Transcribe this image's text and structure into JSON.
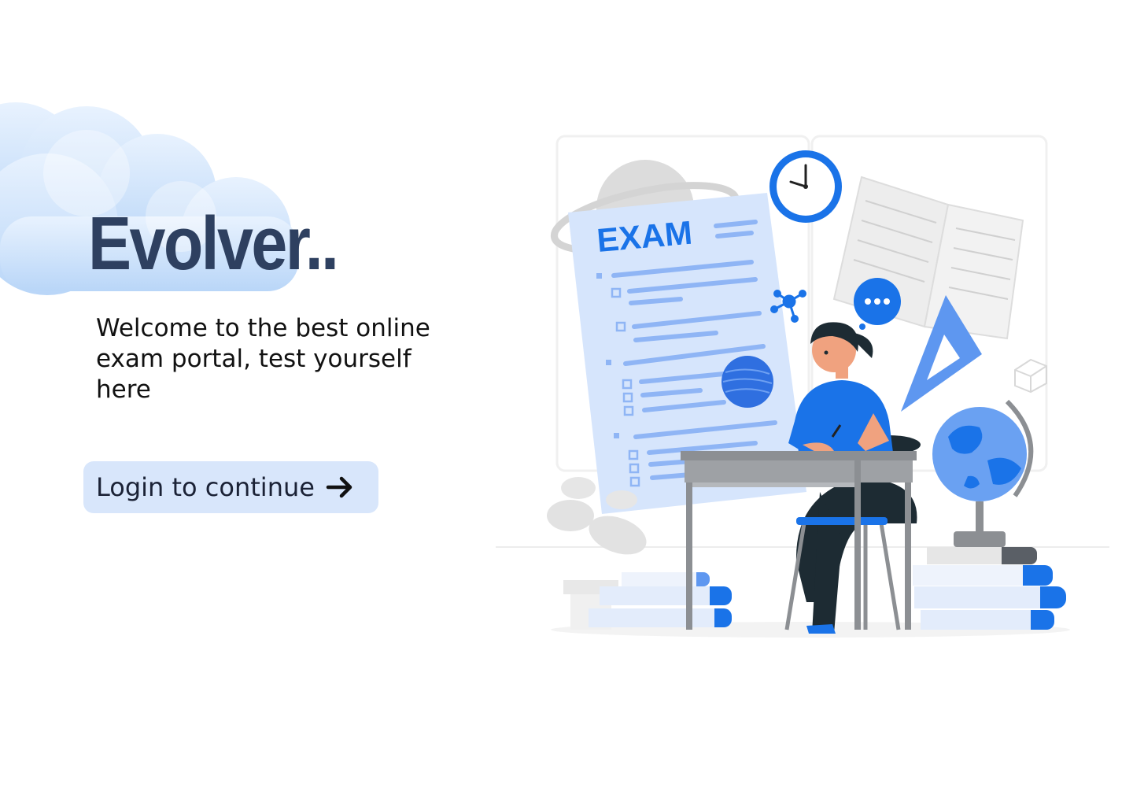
{
  "brand": {
    "name": "Evolver.."
  },
  "hero": {
    "tagline": "Welcome to the best online exam portal, test yourself here",
    "cta_label": "Login to continue",
    "cta_icon": "arrow-right-icon"
  },
  "illustration": {
    "exam_label": "EXAM"
  },
  "colors": {
    "brand_text": "#2e4060",
    "accent_blue": "#1a73e8",
    "cta_background": "#d8e6fb",
    "cloud": "#cfe2fb"
  }
}
